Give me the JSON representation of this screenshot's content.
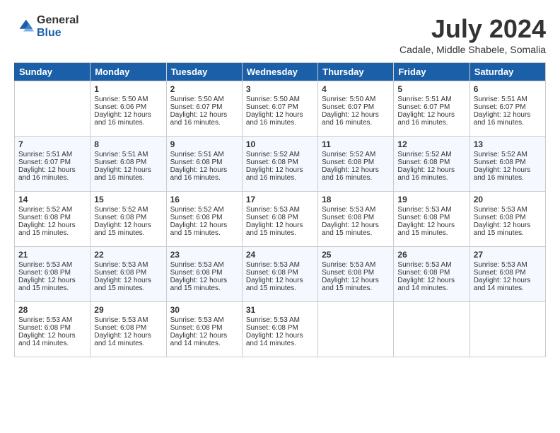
{
  "header": {
    "logo_general": "General",
    "logo_blue": "Blue",
    "month_title": "July 2024",
    "location": "Cadale, Middle Shabele, Somalia"
  },
  "days_of_week": [
    "Sunday",
    "Monday",
    "Tuesday",
    "Wednesday",
    "Thursday",
    "Friday",
    "Saturday"
  ],
  "weeks": [
    [
      {
        "day": "",
        "data": ""
      },
      {
        "day": "1",
        "sunrise": "Sunrise: 5:50 AM",
        "sunset": "Sunset: 6:06 PM",
        "daylight": "Daylight: 12 hours and 16 minutes."
      },
      {
        "day": "2",
        "sunrise": "Sunrise: 5:50 AM",
        "sunset": "Sunset: 6:07 PM",
        "daylight": "Daylight: 12 hours and 16 minutes."
      },
      {
        "day": "3",
        "sunrise": "Sunrise: 5:50 AM",
        "sunset": "Sunset: 6:07 PM",
        "daylight": "Daylight: 12 hours and 16 minutes."
      },
      {
        "day": "4",
        "sunrise": "Sunrise: 5:50 AM",
        "sunset": "Sunset: 6:07 PM",
        "daylight": "Daylight: 12 hours and 16 minutes."
      },
      {
        "day": "5",
        "sunrise": "Sunrise: 5:51 AM",
        "sunset": "Sunset: 6:07 PM",
        "daylight": "Daylight: 12 hours and 16 minutes."
      },
      {
        "day": "6",
        "sunrise": "Sunrise: 5:51 AM",
        "sunset": "Sunset: 6:07 PM",
        "daylight": "Daylight: 12 hours and 16 minutes."
      }
    ],
    [
      {
        "day": "7",
        "sunrise": "Sunrise: 5:51 AM",
        "sunset": "Sunset: 6:07 PM",
        "daylight": "Daylight: 12 hours and 16 minutes."
      },
      {
        "day": "8",
        "sunrise": "Sunrise: 5:51 AM",
        "sunset": "Sunset: 6:08 PM",
        "daylight": "Daylight: 12 hours and 16 minutes."
      },
      {
        "day": "9",
        "sunrise": "Sunrise: 5:51 AM",
        "sunset": "Sunset: 6:08 PM",
        "daylight": "Daylight: 12 hours and 16 minutes."
      },
      {
        "day": "10",
        "sunrise": "Sunrise: 5:52 AM",
        "sunset": "Sunset: 6:08 PM",
        "daylight": "Daylight: 12 hours and 16 minutes."
      },
      {
        "day": "11",
        "sunrise": "Sunrise: 5:52 AM",
        "sunset": "Sunset: 6:08 PM",
        "daylight": "Daylight: 12 hours and 16 minutes."
      },
      {
        "day": "12",
        "sunrise": "Sunrise: 5:52 AM",
        "sunset": "Sunset: 6:08 PM",
        "daylight": "Daylight: 12 hours and 16 minutes."
      },
      {
        "day": "13",
        "sunrise": "Sunrise: 5:52 AM",
        "sunset": "Sunset: 6:08 PM",
        "daylight": "Daylight: 12 hours and 16 minutes."
      }
    ],
    [
      {
        "day": "14",
        "sunrise": "Sunrise: 5:52 AM",
        "sunset": "Sunset: 6:08 PM",
        "daylight": "Daylight: 12 hours and 15 minutes."
      },
      {
        "day": "15",
        "sunrise": "Sunrise: 5:52 AM",
        "sunset": "Sunset: 6:08 PM",
        "daylight": "Daylight: 12 hours and 15 minutes."
      },
      {
        "day": "16",
        "sunrise": "Sunrise: 5:52 AM",
        "sunset": "Sunset: 6:08 PM",
        "daylight": "Daylight: 12 hours and 15 minutes."
      },
      {
        "day": "17",
        "sunrise": "Sunrise: 5:53 AM",
        "sunset": "Sunset: 6:08 PM",
        "daylight": "Daylight: 12 hours and 15 minutes."
      },
      {
        "day": "18",
        "sunrise": "Sunrise: 5:53 AM",
        "sunset": "Sunset: 6:08 PM",
        "daylight": "Daylight: 12 hours and 15 minutes."
      },
      {
        "day": "19",
        "sunrise": "Sunrise: 5:53 AM",
        "sunset": "Sunset: 6:08 PM",
        "daylight": "Daylight: 12 hours and 15 minutes."
      },
      {
        "day": "20",
        "sunrise": "Sunrise: 5:53 AM",
        "sunset": "Sunset: 6:08 PM",
        "daylight": "Daylight: 12 hours and 15 minutes."
      }
    ],
    [
      {
        "day": "21",
        "sunrise": "Sunrise: 5:53 AM",
        "sunset": "Sunset: 6:08 PM",
        "daylight": "Daylight: 12 hours and 15 minutes."
      },
      {
        "day": "22",
        "sunrise": "Sunrise: 5:53 AM",
        "sunset": "Sunset: 6:08 PM",
        "daylight": "Daylight: 12 hours and 15 minutes."
      },
      {
        "day": "23",
        "sunrise": "Sunrise: 5:53 AM",
        "sunset": "Sunset: 6:08 PM",
        "daylight": "Daylight: 12 hours and 15 minutes."
      },
      {
        "day": "24",
        "sunrise": "Sunrise: 5:53 AM",
        "sunset": "Sunset: 6:08 PM",
        "daylight": "Daylight: 12 hours and 15 minutes."
      },
      {
        "day": "25",
        "sunrise": "Sunrise: 5:53 AM",
        "sunset": "Sunset: 6:08 PM",
        "daylight": "Daylight: 12 hours and 15 minutes."
      },
      {
        "day": "26",
        "sunrise": "Sunrise: 5:53 AM",
        "sunset": "Sunset: 6:08 PM",
        "daylight": "Daylight: 12 hours and 14 minutes."
      },
      {
        "day": "27",
        "sunrise": "Sunrise: 5:53 AM",
        "sunset": "Sunset: 6:08 PM",
        "daylight": "Daylight: 12 hours and 14 minutes."
      }
    ],
    [
      {
        "day": "28",
        "sunrise": "Sunrise: 5:53 AM",
        "sunset": "Sunset: 6:08 PM",
        "daylight": "Daylight: 12 hours and 14 minutes."
      },
      {
        "day": "29",
        "sunrise": "Sunrise: 5:53 AM",
        "sunset": "Sunset: 6:08 PM",
        "daylight": "Daylight: 12 hours and 14 minutes."
      },
      {
        "day": "30",
        "sunrise": "Sunrise: 5:53 AM",
        "sunset": "Sunset: 6:08 PM",
        "daylight": "Daylight: 12 hours and 14 minutes."
      },
      {
        "day": "31",
        "sunrise": "Sunrise: 5:53 AM",
        "sunset": "Sunset: 6:08 PM",
        "daylight": "Daylight: 12 hours and 14 minutes."
      },
      {
        "day": "",
        "data": ""
      },
      {
        "day": "",
        "data": ""
      },
      {
        "day": "",
        "data": ""
      }
    ]
  ]
}
